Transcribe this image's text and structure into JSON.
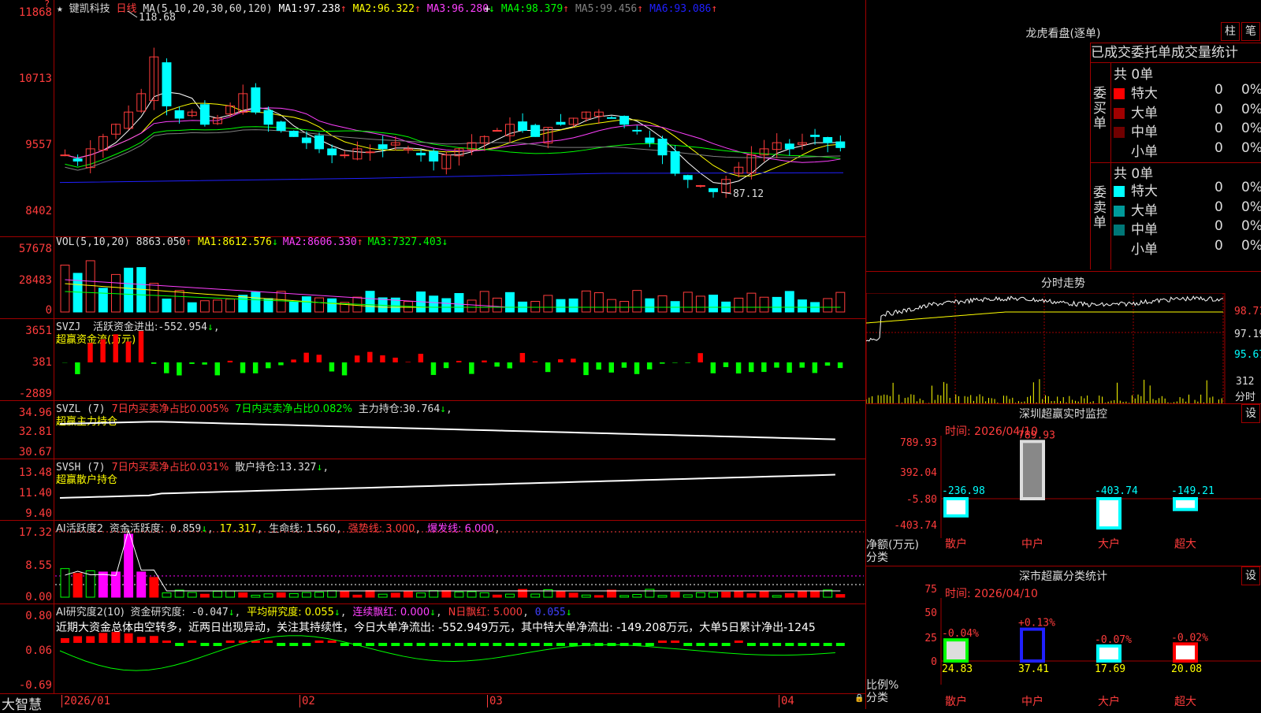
{
  "colors": {
    "up": "#ff3c3c",
    "down": "#00ffff",
    "ma1": "#ffffff",
    "ma2": "#ffff00",
    "ma3": "#ff40ff",
    "ma4": "#00ff00",
    "ma5": "#808080",
    "ma6": "#2020ff",
    "green": "#00ff00",
    "magenta": "#ff00ff",
    "border": "#a00000"
  },
  "icons": {
    "star": "★",
    "corner": "?",
    "lock": "🔒",
    "cross": "+"
  },
  "main": {
    "stock_name": "键凯科技",
    "period": "日线",
    "ma_params": "MA(5,10,20,30,60,120)",
    "ma": [
      {
        "label": "MA1:",
        "value": "97.238",
        "arrow": "↑"
      },
      {
        "label": "MA2:",
        "value": "96.322",
        "arrow": "↑"
      },
      {
        "label": "MA3:",
        "value": "96.280",
        "arrow": "↓"
      },
      {
        "label": "MA4:",
        "value": "98.379",
        "arrow": "↑"
      },
      {
        "label": "MA5:",
        "value": "99.456",
        "arrow": "↑"
      },
      {
        "label": "MA6:",
        "value": "93.086",
        "arrow": "↑"
      }
    ],
    "y_labels": [
      "11868",
      "10713",
      "9557",
      "8402"
    ],
    "high_mark": "118.68",
    "low_mark": "87.12"
  },
  "vol": {
    "params": "VOL(5,10,20)",
    "value": "8863.050",
    "arrow": "↑",
    "ma": [
      {
        "label": "MA1:",
        "value": "8612.576",
        "arrow": "↓"
      },
      {
        "label": "MA2:",
        "value": "8606.330",
        "arrow": "↑"
      },
      {
        "label": "MA3:",
        "value": "7327.403",
        "arrow": "↓"
      }
    ],
    "y_labels": [
      "57678",
      "28483",
      "0"
    ]
  },
  "svzj": {
    "name": "SVZJ",
    "label": "活跃资金进出:",
    "value": "-552.954",
    "arrow": "↓",
    "sub": "超赢资金流(万元)",
    "y_labels": [
      "3651",
      "381",
      "-2889"
    ]
  },
  "svzl": {
    "name": "SVZL (7)",
    "t1": "7日内买卖净占比0.005%",
    "t2": "7日内买卖净占比0.082%",
    "label": "主力持仓:",
    "value": "30.764",
    "arrow": "↓",
    "sub": "超赢主力持仓",
    "y_labels": [
      "34.96",
      "32.81",
      "30.67"
    ]
  },
  "svsh": {
    "name": "SVSH (7)",
    "t1": "7日内买卖净占比0.031%",
    "label": "散户持仓:",
    "value": "13.327",
    "arrow": "↓",
    "sub": "超赢散户持仓",
    "y_labels": [
      "13.48",
      "11.40",
      "9.40"
    ]
  },
  "ai1": {
    "name": "AI活跃度2",
    "label": "资金活跃度:",
    "value": "0.859",
    "arrow": "↓",
    "v2": "17.317",
    "life": "生命线: 1.560",
    "strong": "强势线: 3.000",
    "burst": "爆发线: 6.000",
    "y_labels": [
      "17.32",
      "8.55",
      "0.00"
    ]
  },
  "ai2": {
    "name": "AI研究度2(10)",
    "label": "资金研究度:",
    "value": "-0.047",
    "arrow": "↓",
    "avg": "平均研究度: 0.055",
    "avg_arrow": "↓",
    "red": "连续飘红: 0.000",
    "red_arrow": "↓",
    "n": "N日飘红: 5.000",
    "blue": "0.055",
    "blue_arrow": "↓",
    "comment": "近期大资金总体由空转多，近两日出现异动，关注其持续性，今日大单净流出: -552.949万元，其中特大单净流出: -149.208万元，大单5日累计净出-1245",
    "y_labels": [
      "0.80",
      "0.06",
      "-0.69"
    ]
  },
  "xaxis": {
    "labels": [
      "2026/01",
      "02",
      "03",
      "04"
    ]
  },
  "brand": "大智慧",
  "lhb": {
    "title": "龙虎看盘(逐单)",
    "btn1": "柱",
    "btn2": "笔",
    "tabs": [
      "已成交",
      "委托单",
      "成交量",
      "统计"
    ],
    "buy": {
      "side": "委买单",
      "total": "共 0单",
      "rows": [
        {
          "name": "特大",
          "count": "0",
          "pct": "0%",
          "color": "#ff0000"
        },
        {
          "name": "大单",
          "count": "0",
          "pct": "0%",
          "color": "#a00000"
        },
        {
          "name": "中单",
          "count": "0",
          "pct": "0%",
          "color": "#700000"
        },
        {
          "name": "小单",
          "count": "0",
          "pct": "0%",
          "color": "#000000"
        }
      ]
    },
    "sell": {
      "side": "委卖单",
      "total": "共 0单",
      "rows": [
        {
          "name": "特大",
          "count": "0",
          "pct": "0%",
          "color": "#00ffff"
        },
        {
          "name": "大单",
          "count": "0",
          "pct": "0%",
          "color": "#009999"
        },
        {
          "name": "中单",
          "count": "0",
          "pct": "0%",
          "color": "#007777"
        },
        {
          "name": "小单",
          "count": "0",
          "pct": "0%",
          "color": "#000000"
        }
      ]
    }
  },
  "fs": {
    "title": "分时走势",
    "y_labels": [
      "98.71",
      "97.19",
      "95.67"
    ],
    "vol_label": "312",
    "vol_unit": "分时"
  },
  "sz_monitor": {
    "title": "深圳超赢实时监控",
    "btn": "设",
    "time": "时间: 2026/04/10",
    "unit": "净额(万元)",
    "cat_label": "分类",
    "y_labels": [
      "789.93",
      "392.04",
      "-5.80",
      "-403.74"
    ],
    "bars": [
      {
        "name": "散户",
        "value": -236.98,
        "label": "-236.98"
      },
      {
        "name": "中户",
        "value": 789.93,
        "label": "789.93"
      },
      {
        "name": "大户",
        "value": -403.74,
        "label": "-403.74"
      },
      {
        "name": "超大",
        "value": -149.21,
        "label": "-149.21"
      }
    ]
  },
  "sz_class": {
    "title": "深市超赢分类统计",
    "btn": "设",
    "time": "时间: 2026/04/10",
    "unit": "比例%",
    "cat_label": "分类",
    "y_labels": [
      "75",
      "50",
      "25",
      "0"
    ],
    "bars": [
      {
        "name": "散户",
        "value": 24.83,
        "label": "24.83",
        "change": "-0.04%"
      },
      {
        "name": "中户",
        "value": 37.41,
        "label": "37.41",
        "change": "+0.13%"
      },
      {
        "name": "大户",
        "value": 17.69,
        "label": "17.69",
        "change": "-0.07%"
      },
      {
        "name": "超大",
        "value": 20.08,
        "label": "20.08",
        "change": "-0.02%"
      }
    ]
  }
}
